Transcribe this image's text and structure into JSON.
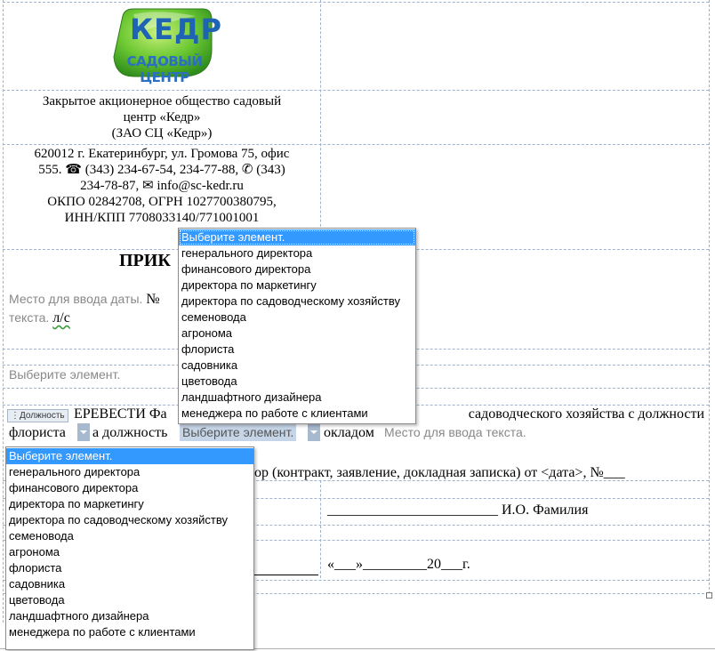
{
  "logo": {
    "name": "Кедр",
    "subtitle": "Садовый центр",
    "color_leaf": "#5fc22f",
    "color_text": "#1f63b5"
  },
  "company": {
    "line1": "Закрытое акционерное общество садовый",
    "line2": "центр «Кедр»",
    "line3": "(ЗАО СЦ «Кедр»)"
  },
  "address": {
    "line1": "620012 г. Екатеринбург, ул. Громова 75, офис",
    "line2": "555. ☎ (343) 234-67-54, 234-77-88, ✆ (343)",
    "line3": "234-78-87, ✉ info@sc-kedr.ru",
    "line4": "ОКПО 02842708, ОГРН 1027700380795,",
    "line5": "ИНН/КПП 7708033140/771001001"
  },
  "order": {
    "title_partial": "ПРИК",
    "date_placeholder": "Место для ввода даты.",
    "number_sign": "№",
    "text_placeholder_end": "текста.",
    "suffix": "л/с",
    "select_placeholder": "Выберите элемент."
  },
  "body": {
    "tag": "Должность",
    "transfer_prefix": "ЕРЕВЕСТИ Фа",
    "transfer_rest": "садоводческого хозяйства с должности",
    "from_word": "флориста",
    "to_position": "а должность",
    "inline_select": "Выберите элемент.",
    "salary": "окладом",
    "text_placeholder": "Место для ввода текста.",
    "basis": "ор (контракт, заявление, докладная записка) от <дата>, №___",
    "signature_line": "________________________ И.О. Фамилия",
    "date_line": "«___»_________20___г."
  },
  "dropdown_top": {
    "options": [
      "Выберите элемент.",
      "генерального директора",
      "финансового директора",
      "директора по маркетингу",
      "директора по садоводческому хозяйству",
      "семеновода",
      "агронома",
      "флориста",
      "садовника",
      "цветовода",
      "ландшафтного дизайнера",
      "менеджера по работе с клиентами"
    ]
  },
  "dropdown_bottom": {
    "options": [
      "Выберите элемент.",
      "генерального директора",
      "финансового директора",
      "директора по маркетингу",
      "директора по садоводческому хозяйству",
      "семеновода",
      "агронома",
      "флориста",
      "садовника",
      "цветовода",
      "ландшафтного дизайнера",
      "менеджера по работе с клиентами"
    ]
  },
  "colors": {
    "highlight": "#3399ff",
    "grid": "#9db3cf"
  }
}
